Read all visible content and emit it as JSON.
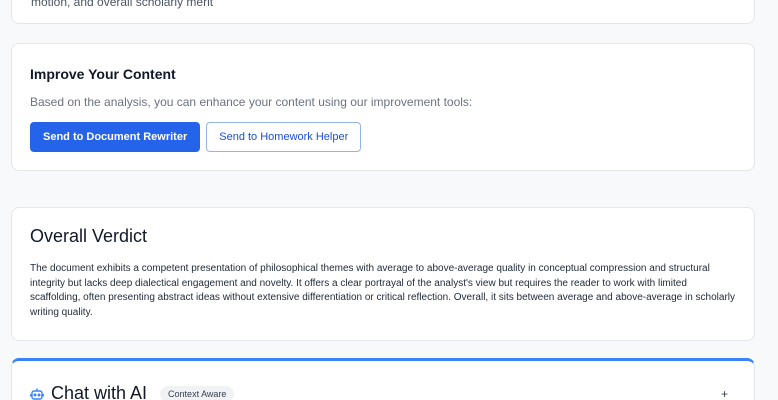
{
  "top_card": {
    "text": "motion, and overall scholarly merit"
  },
  "improve": {
    "title": "Improve Your Content",
    "description": "Based on the analysis, you can enhance your content using our improvement tools:",
    "primary_button": "Send to Document Rewriter",
    "secondary_button": "Send to Homework Helper"
  },
  "verdict": {
    "title": "Overall Verdict",
    "body": "The document exhibits a competent presentation of philosophical themes with average to above-average quality in conceptual compression and structural integrity but lacks deep dialectical engagement and novelty. It offers a clear portrayal of the analyst's view but requires the reader to work with limited scaffolding, often presenting abstract ideas without extensive differentiation or critical reflection. Overall, it sits between average and above-average in scholarly writing quality."
  },
  "chat": {
    "title": "Chat with AI",
    "badge": "Context Aware",
    "expand_icon": "+"
  },
  "colors": {
    "accent": "#2563eb",
    "chat_top_border": "#3b82f6"
  },
  "icons": {
    "chat": "bot-icon"
  }
}
